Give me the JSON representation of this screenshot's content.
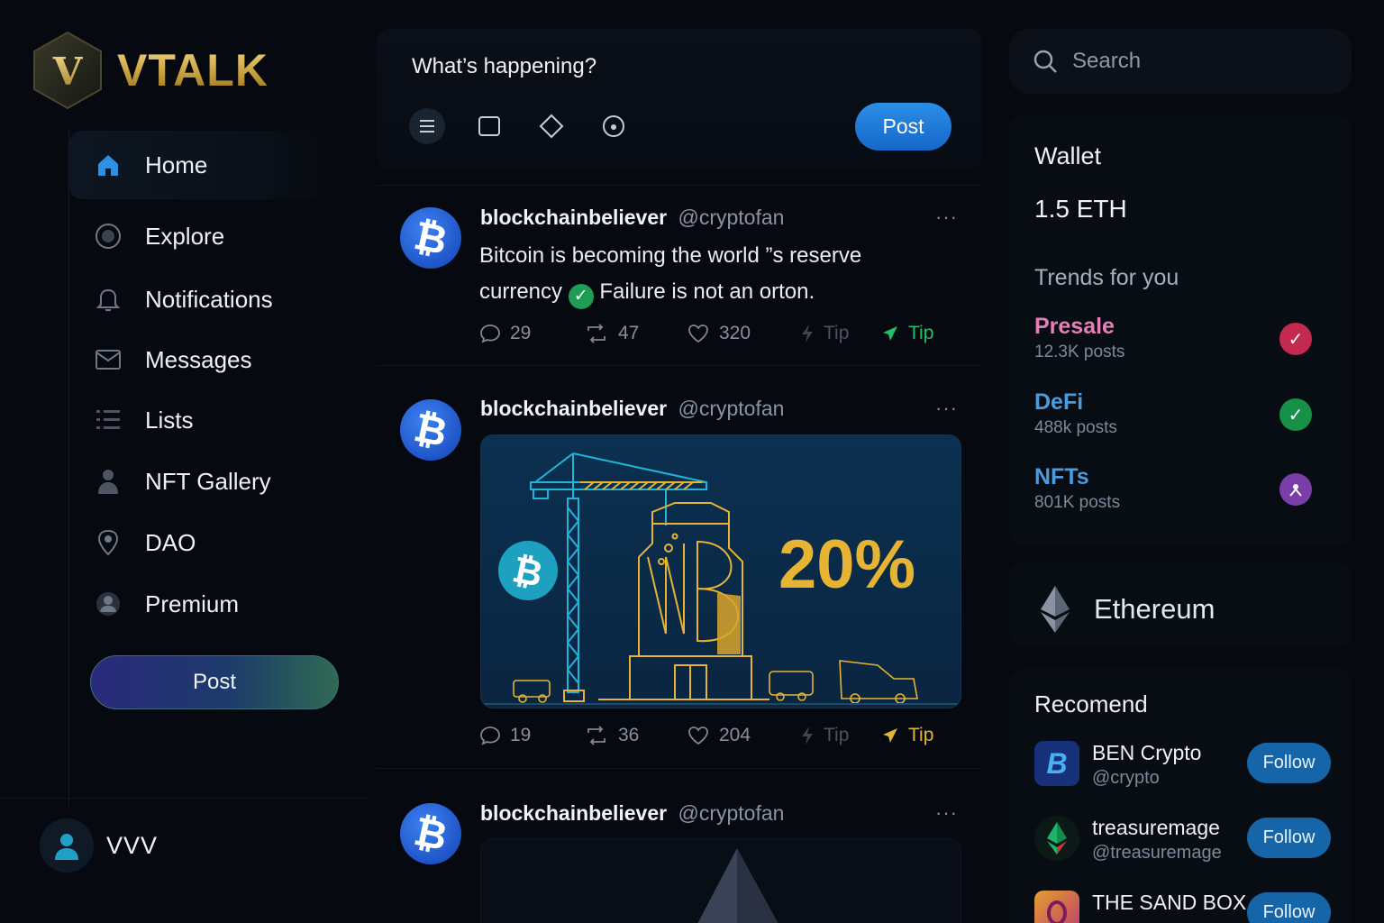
{
  "brand": {
    "name": "VTALK",
    "mark": "V"
  },
  "nav": {
    "items": [
      {
        "label": "Home",
        "icon": "home-icon",
        "active": true
      },
      {
        "label": "Explore",
        "icon": "explore-icon"
      },
      {
        "label": "Notifications",
        "icon": "bell-icon"
      },
      {
        "label": "Messages",
        "icon": "mail-icon"
      },
      {
        "label": "Lists",
        "icon": "list-icon"
      },
      {
        "label": "NFT Gallery",
        "icon": "person-icon"
      },
      {
        "label": "DAO",
        "icon": "pin-icon"
      },
      {
        "label": "Premium",
        "icon": "premium-icon"
      }
    ],
    "post_label": "Post"
  },
  "user": {
    "name": "VVV"
  },
  "composer": {
    "placeholder": "What’s happening?",
    "post_label": "Post"
  },
  "feed": {
    "tweets": [
      {
        "name": "blockchainbeliever",
        "handle": "@cryptofan",
        "text_a": "Bitcoin is becoming the world ”s reserve",
        "text_b": "currency",
        "text_c": "Failure is not an orton.",
        "replies": "29",
        "reposts": "47",
        "likes": "320",
        "tip_a": "Tip",
        "tip_b": "Tip"
      },
      {
        "name": "blockchainbeliever",
        "handle": "@cryptofan",
        "media_text": "20%",
        "replies": "19",
        "reposts": "36",
        "likes": "204",
        "tip_a": "Tip",
        "tip_b": "Tip"
      },
      {
        "name": "blockchainbeliever",
        "handle": "@cryptofan"
      }
    ],
    "more": "···"
  },
  "search": {
    "placeholder": "Search"
  },
  "wallet": {
    "title": "Wallet",
    "amount": "1.5 ETH"
  },
  "trends": {
    "title": "Trends for you",
    "items": [
      {
        "name": "Presale",
        "count": "12.3K posts",
        "color": "#e67fb8",
        "badge_color": "#c42a4f"
      },
      {
        "name": "DeFi",
        "count": "488k posts",
        "color": "#4a9be0",
        "badge_color": "#179048"
      },
      {
        "name": "NFTs",
        "count": "801K posts",
        "color": "#4a9be0",
        "badge_color": "#7b3da8"
      }
    ]
  },
  "ethereum": {
    "label": "Ethereum"
  },
  "recommend": {
    "title": "Recomend",
    "items": [
      {
        "name": "BEN Crypto",
        "handle": "@crypto",
        "follow": "Follow"
      },
      {
        "name": "treasuremage",
        "handle": "@treasuremage",
        "follow": "Follow"
      },
      {
        "name": "THE SAND BOX",
        "handle": "",
        "follow": "Follow"
      }
    ]
  }
}
